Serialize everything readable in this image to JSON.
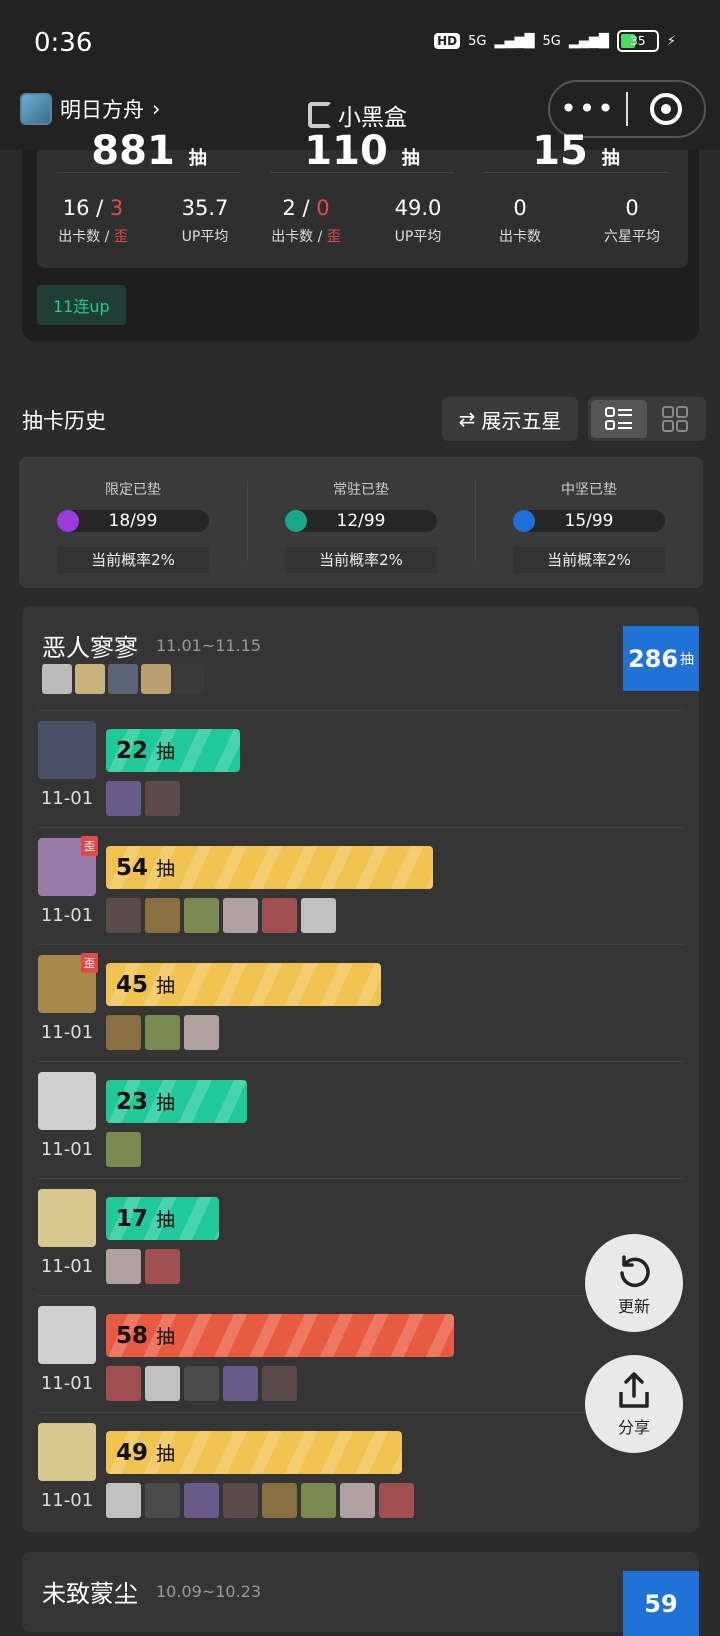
{
  "status_bar": {
    "time": "0:36",
    "hd": "HD",
    "net1": "5G",
    "net2": "5G",
    "battery": "35"
  },
  "nav": {
    "app_name": "明日方舟",
    "brand": "小黑盒"
  },
  "stats": [
    {
      "big": "881",
      "big_unit": "抽",
      "a_val_main": "16 / ",
      "a_val_red": "3",
      "a_label": "出卡数 / ",
      "a_label_red": "歪",
      "b_val": "35.7",
      "b_label": "UP平均"
    },
    {
      "big": "110",
      "big_unit": "抽",
      "a_val_main": "2 / ",
      "a_val_red": "0",
      "a_label": "出卡数 / ",
      "a_label_red": "歪",
      "b_val": "49.0",
      "b_label": "UP平均"
    },
    {
      "big": "15",
      "big_unit": "抽",
      "a_val_main": "0",
      "a_val_red": "",
      "a_label": "出卡数",
      "a_label_red": "",
      "b_val": "0",
      "b_label": "六星平均"
    }
  ],
  "tag_11": "11连up",
  "history": {
    "title": "抽卡历史",
    "toggle_label": "展示五星"
  },
  "pity": [
    {
      "title": "限定已垫",
      "value": "18/99",
      "prob": "当前概率2%",
      "color": "#9a3bdc"
    },
    {
      "title": "常驻已垫",
      "value": "12/99",
      "prob": "当前概率2%",
      "color": "#1aa88c"
    },
    {
      "title": "中坚已垫",
      "value": "15/99",
      "prob": "当前概率2%",
      "color": "#1f6fd8"
    }
  ],
  "banner": {
    "name": "恶人寥寥",
    "date": "11.01~11.15",
    "total": "286",
    "total_unit": "抽",
    "pulls": [
      {
        "count": "22",
        "unit": "抽",
        "date": "11-01",
        "color": "green",
        "wai": "",
        "fraction": 0.38,
        "thumbs": 2
      },
      {
        "count": "54",
        "unit": "抽",
        "date": "11-01",
        "color": "yellow",
        "wai": "歪",
        "fraction": 0.93,
        "thumbs": 6
      },
      {
        "count": "45",
        "unit": "抽",
        "date": "11-01",
        "color": "yellow",
        "wai": "歪",
        "fraction": 0.78,
        "thumbs": 3
      },
      {
        "count": "23",
        "unit": "抽",
        "date": "11-01",
        "color": "green",
        "wai": "",
        "fraction": 0.4,
        "thumbs": 1
      },
      {
        "count": "17",
        "unit": "抽",
        "date": "11-01",
        "color": "green",
        "wai": "",
        "fraction": 0.32,
        "thumbs": 2
      },
      {
        "count": "58",
        "unit": "抽",
        "date": "11-01",
        "color": "red",
        "wai": "",
        "fraction": 0.99,
        "thumbs": 5
      },
      {
        "count": "49",
        "unit": "抽",
        "date": "11-01",
        "color": "yellow",
        "wai": "",
        "fraction": 0.84,
        "thumbs": 8
      }
    ]
  },
  "banner2": {
    "name": "未致蒙尘",
    "date": "10.09~10.23",
    "total": "59"
  },
  "fab": {
    "refresh": "更新",
    "share": "分享"
  }
}
